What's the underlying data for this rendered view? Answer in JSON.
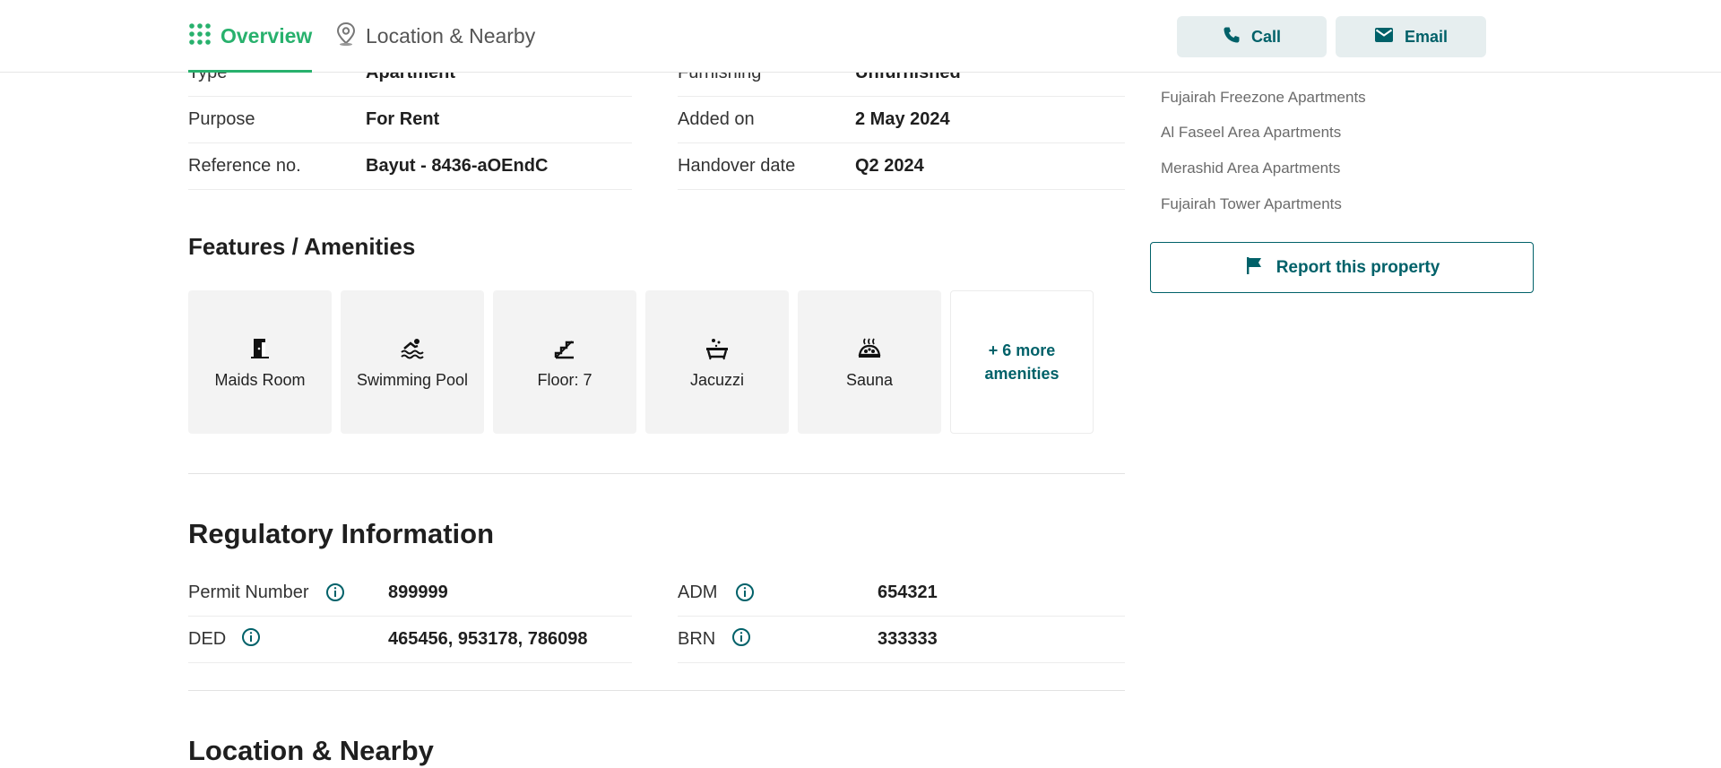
{
  "header": {
    "tabs": [
      {
        "label": "Overview",
        "icon": "grid-dots-icon",
        "active": true
      },
      {
        "label": "Location & Nearby",
        "icon": "map-pin-icon",
        "active": false
      }
    ],
    "call_label": "Call",
    "email_label": "Email"
  },
  "details": {
    "left": [
      {
        "key": "Type",
        "value": "Apartment"
      },
      {
        "key": "Purpose",
        "value": "For Rent"
      },
      {
        "key": "Reference no.",
        "value": "Bayut - 8436-aOEndC"
      }
    ],
    "right": [
      {
        "key": "Furnishing",
        "value": "Unfurnished"
      },
      {
        "key": "Added on",
        "value": "2 May 2024"
      },
      {
        "key": "Handover date",
        "value": "Q2 2024"
      }
    ]
  },
  "features": {
    "title": "Features / Amenities",
    "items": [
      {
        "label": "Maids Room",
        "icon": "door-icon"
      },
      {
        "label": "Swimming Pool",
        "icon": "swimmer-icon"
      },
      {
        "label": "Floor: 7",
        "icon": "stairs-icon"
      },
      {
        "label": "Jacuzzi",
        "icon": "bathtub-icon"
      },
      {
        "label": "Sauna",
        "icon": "sauna-icon"
      }
    ],
    "more_line1": "+ 6 more",
    "more_line2": "amenities"
  },
  "regulatory": {
    "title": "Regulatory Information",
    "left": [
      {
        "key": "Permit Number",
        "value": "899999"
      },
      {
        "key": "DED",
        "value": "465456, 953178, 786098"
      }
    ],
    "right": [
      {
        "key": "ADM",
        "value": "654321"
      },
      {
        "key": "BRN",
        "value": "333333"
      }
    ]
  },
  "location_title": "Location & Nearby",
  "sidebar": {
    "links": [
      "Fujairah Freezone Apartments",
      "Al Faseel Area Apartments",
      "Merashid Area Apartments",
      "Fujairah Tower Apartments"
    ],
    "report_label": "Report this property"
  },
  "colors": {
    "accent_green": "#28b16d",
    "brand_teal": "#006169",
    "button_bg": "#e6eeef"
  }
}
